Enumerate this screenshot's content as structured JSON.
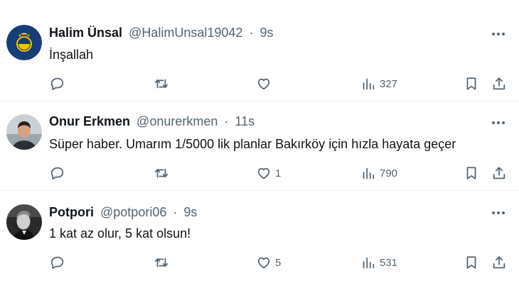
{
  "tweets": [
    {
      "name": "Halim Ünsal",
      "handle": "@HalimUnsal19042",
      "time": "9s",
      "text": "İnşallah",
      "likes": "",
      "views": "327",
      "avatar": "fenerbahce-logo"
    },
    {
      "name": "Onur Erkmen",
      "handle": "@onurerkmen",
      "time": "11s",
      "text": "Süper haber. Umarım 1/5000 lik planlar Bakırköy için hızla hayata geçer",
      "likes": "1",
      "views": "790",
      "avatar": "person-photo"
    },
    {
      "name": "Potpori",
      "handle": "@potpori06",
      "time": "9s",
      "text": "1 kat az olur, 5 kat olsun!",
      "likes": "5",
      "views": "531",
      "avatar": "ataturk-photo"
    }
  ],
  "separator": "·",
  "colors": {
    "text": "#0f1419",
    "secondary": "#536471",
    "divider": "#eff3f4",
    "logo_navy": "#173d78",
    "logo_yellow": "#f4c400"
  },
  "icons": [
    "reply-icon",
    "retweet-icon",
    "like-icon",
    "views-icon",
    "bookmark-icon",
    "share-icon",
    "more-icon"
  ]
}
